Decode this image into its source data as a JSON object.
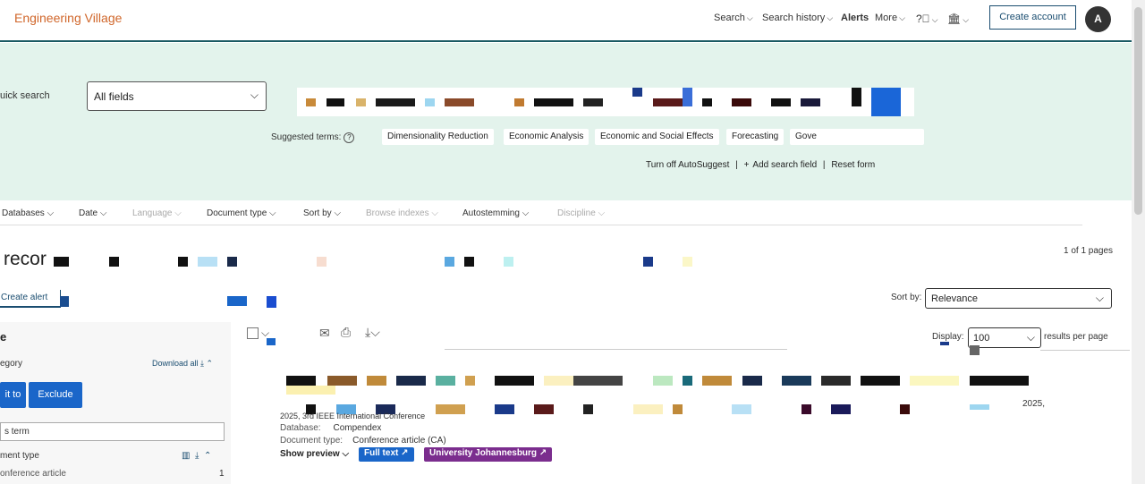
{
  "header": {
    "logo": "Engineering Village",
    "nav": {
      "search": "Search",
      "history": "Search history",
      "alerts": "Alerts",
      "more": "More"
    },
    "create_account": "Create account",
    "avatar_initial": "A"
  },
  "search": {
    "quick_search_label": "uick search",
    "field_value": "All fields",
    "suggested_label": "Suggested terms:",
    "suggestions": [
      "Dimensionality Reduction",
      "Economic Analysis",
      "Economic and Social Effects",
      "Forecasting",
      "Gove"
    ],
    "turn_off": "Turn off AutoSuggest",
    "add_field": "Add search field",
    "reset": "Reset form"
  },
  "filters": [
    "Databases",
    "Date",
    "Language",
    "Document type",
    "Sort by",
    "Browse indexes",
    "Autostemming",
    "Discipline"
  ],
  "results": {
    "records_partial": "recor",
    "pages": "1 of 1 pages",
    "create_alert": "Create alert",
    "sort_by_label": "Sort by:",
    "sort_value": "Relevance",
    "display_label": "Display:",
    "display_value": "100",
    "per_page": "results per page",
    "item": {
      "conference": "2025, 3rd IEEE International Conference",
      "year_tail": "2025,",
      "database_label": "Database:",
      "database_value": "Compendex",
      "doctype_label": "Document type:",
      "doctype_value": "Conference article (CA)",
      "show_preview": "Show preview",
      "full_text": "Full text",
      "university": "University Johannesburg"
    }
  },
  "left_panel": {
    "title": "e",
    "category": "egory",
    "download_all": "Download all",
    "limit_btn": "it to",
    "exclude_btn": "Exclude",
    "input_placeholder": "s term",
    "doc_type": "ment type",
    "conf_article": "onference article",
    "conf_count": "1"
  },
  "colors": {
    "brand": "#d0662a",
    "band": "#e3f3ec",
    "primary": "#1a66c9",
    "dark_blue": "#1a4d70",
    "university_badge": "#7b2d8e"
  }
}
